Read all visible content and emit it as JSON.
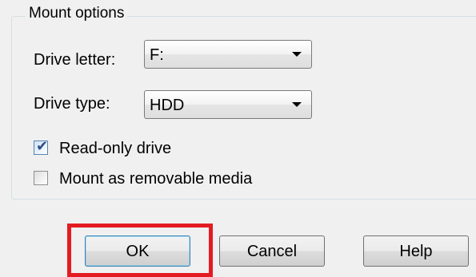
{
  "mount_options": {
    "title": "Mount options",
    "drive_letter": {
      "label": "Drive letter:",
      "value": "F:"
    },
    "drive_type": {
      "label": "Drive type:",
      "value": "HDD"
    },
    "read_only": {
      "label": "Read-only drive",
      "checked": true,
      "checkmark": "✔"
    },
    "removable": {
      "label": "Mount as removable media",
      "checked": false
    }
  },
  "buttons": {
    "ok": "OK",
    "cancel": "Cancel",
    "help": "Help"
  },
  "colors": {
    "highlight": "#e31b23",
    "background": "#f0f0f0"
  },
  "icons": {
    "dropdown": "chevron-down-icon",
    "check": "checkmark-icon"
  }
}
